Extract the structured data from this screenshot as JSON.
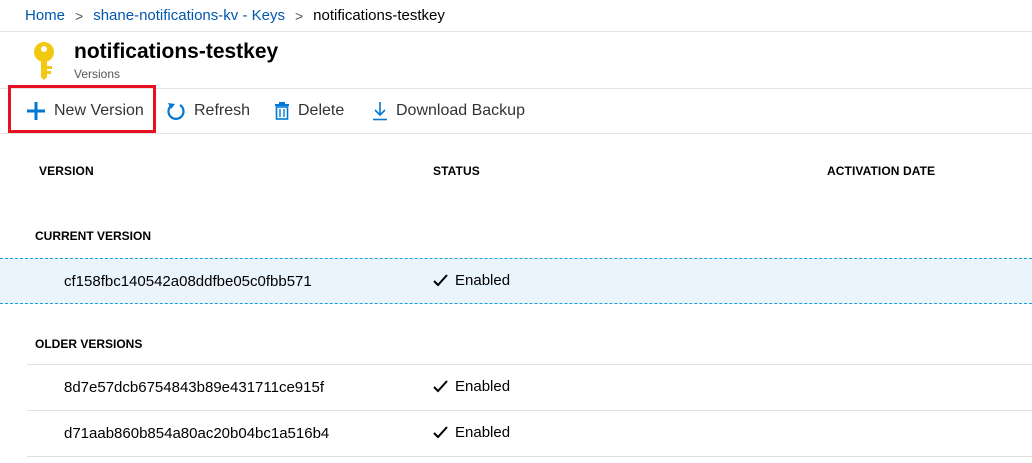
{
  "breadcrumb": {
    "home": "Home",
    "vault": "shane-notifications-kv - Keys",
    "current": "notifications-testkey",
    "separator": ">"
  },
  "header": {
    "icon": "key-icon",
    "title": "notifications-testkey",
    "subtitle": "Versions"
  },
  "toolbar": {
    "new_version": "New Version",
    "refresh": "Refresh",
    "delete": "Delete",
    "download_backup": "Download Backup"
  },
  "table": {
    "columns": [
      "VERSION",
      "STATUS",
      "ACTIVATION DATE"
    ],
    "current_label": "CURRENT VERSION",
    "older_label": "OLDER VERSIONS",
    "current": [
      {
        "version": "cf158fbc140542a08ddfbe05c0fbb571",
        "status": "Enabled"
      }
    ],
    "older": [
      {
        "version": "8d7e57dcb6754843b89e431711ce915f",
        "status": "Enabled"
      },
      {
        "version": "d71aab860b854a80ac20b04bc1a516b4",
        "status": "Enabled"
      }
    ]
  },
  "colors": {
    "link": "#0058ad",
    "accent": "#0078d4",
    "highlight": "#e81123",
    "key_icon": "#f2c811",
    "selected_row": "#eaf4fc"
  }
}
